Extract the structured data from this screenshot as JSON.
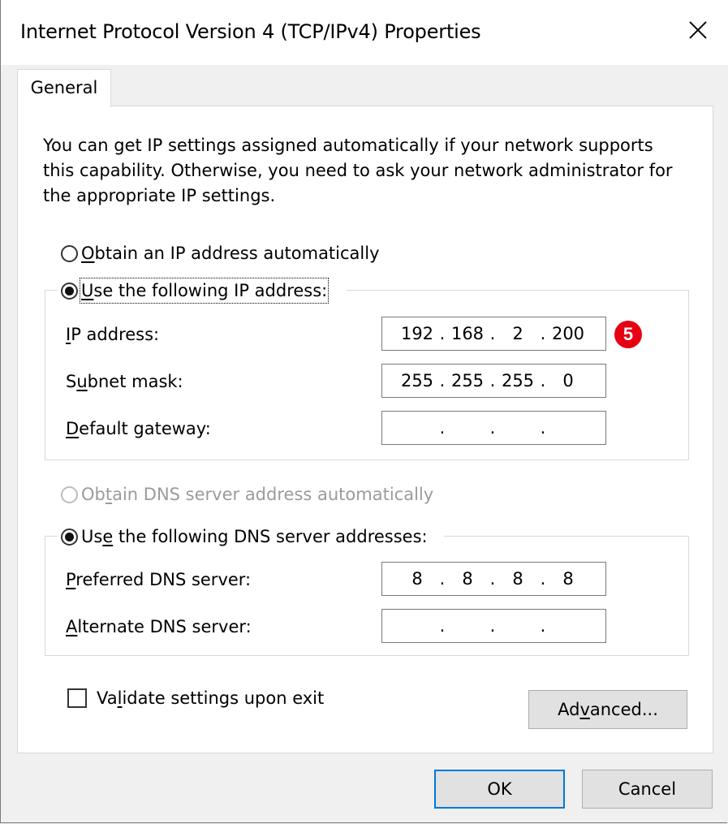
{
  "window": {
    "title": "Internet Protocol Version 4 (TCP/IPv4) Properties",
    "close_icon": "close-icon"
  },
  "tabs": [
    {
      "label": "General",
      "selected": true
    }
  ],
  "intro_text": "You can get IP settings assigned automatically if your network supports this capability. Otherwise, you need to ask your network administrator for the appropriate IP settings.",
  "ip_mode": {
    "auto": {
      "prefix": "",
      "accel": "O",
      "rest": "btain an IP address automatically",
      "checked": false
    },
    "manual": {
      "prefix": "",
      "accel": "U",
      "rest": "se the following IP address:",
      "checked": true
    }
  },
  "ip_fields": {
    "ip_address": {
      "label_accel": "I",
      "label_rest": "P address:",
      "octets": [
        "192",
        "168",
        "2",
        "200"
      ]
    },
    "subnet_mask": {
      "label_pre": "S",
      "label_accel": "u",
      "label_rest": "bnet mask:",
      "octets": [
        "255",
        "255",
        "255",
        "0"
      ]
    },
    "default_gateway": {
      "label_accel": "D",
      "label_rest": "efault gateway:",
      "octets": [
        "",
        "",
        "",
        ""
      ]
    }
  },
  "dns_mode": {
    "auto": {
      "pre": "Ob",
      "accel": "t",
      "rest": "ain DNS server address automatically",
      "checked": false,
      "disabled": true
    },
    "manual": {
      "pre": "Us",
      "accel": "e",
      "rest": " the following DNS server addresses:",
      "checked": true
    }
  },
  "dns_fields": {
    "preferred": {
      "label_accel": "P",
      "label_rest": "referred DNS server:",
      "octets": [
        "8",
        "8",
        "8",
        "8"
      ]
    },
    "alternate": {
      "label_accel": "A",
      "label_rest": "lternate DNS server:",
      "octets": [
        "",
        "",
        "",
        ""
      ]
    }
  },
  "annotation_badge": "5",
  "validate": {
    "pre": "Va",
    "accel": "l",
    "rest": "idate settings upon exit",
    "checked": false
  },
  "buttons": {
    "advanced": {
      "pre": "Ad",
      "accel": "v",
      "rest": "anced..."
    },
    "ok": "OK",
    "cancel": "Cancel"
  },
  "dot": ".",
  "colors": {
    "accent": "#0078d7",
    "badge": "#e60012"
  }
}
